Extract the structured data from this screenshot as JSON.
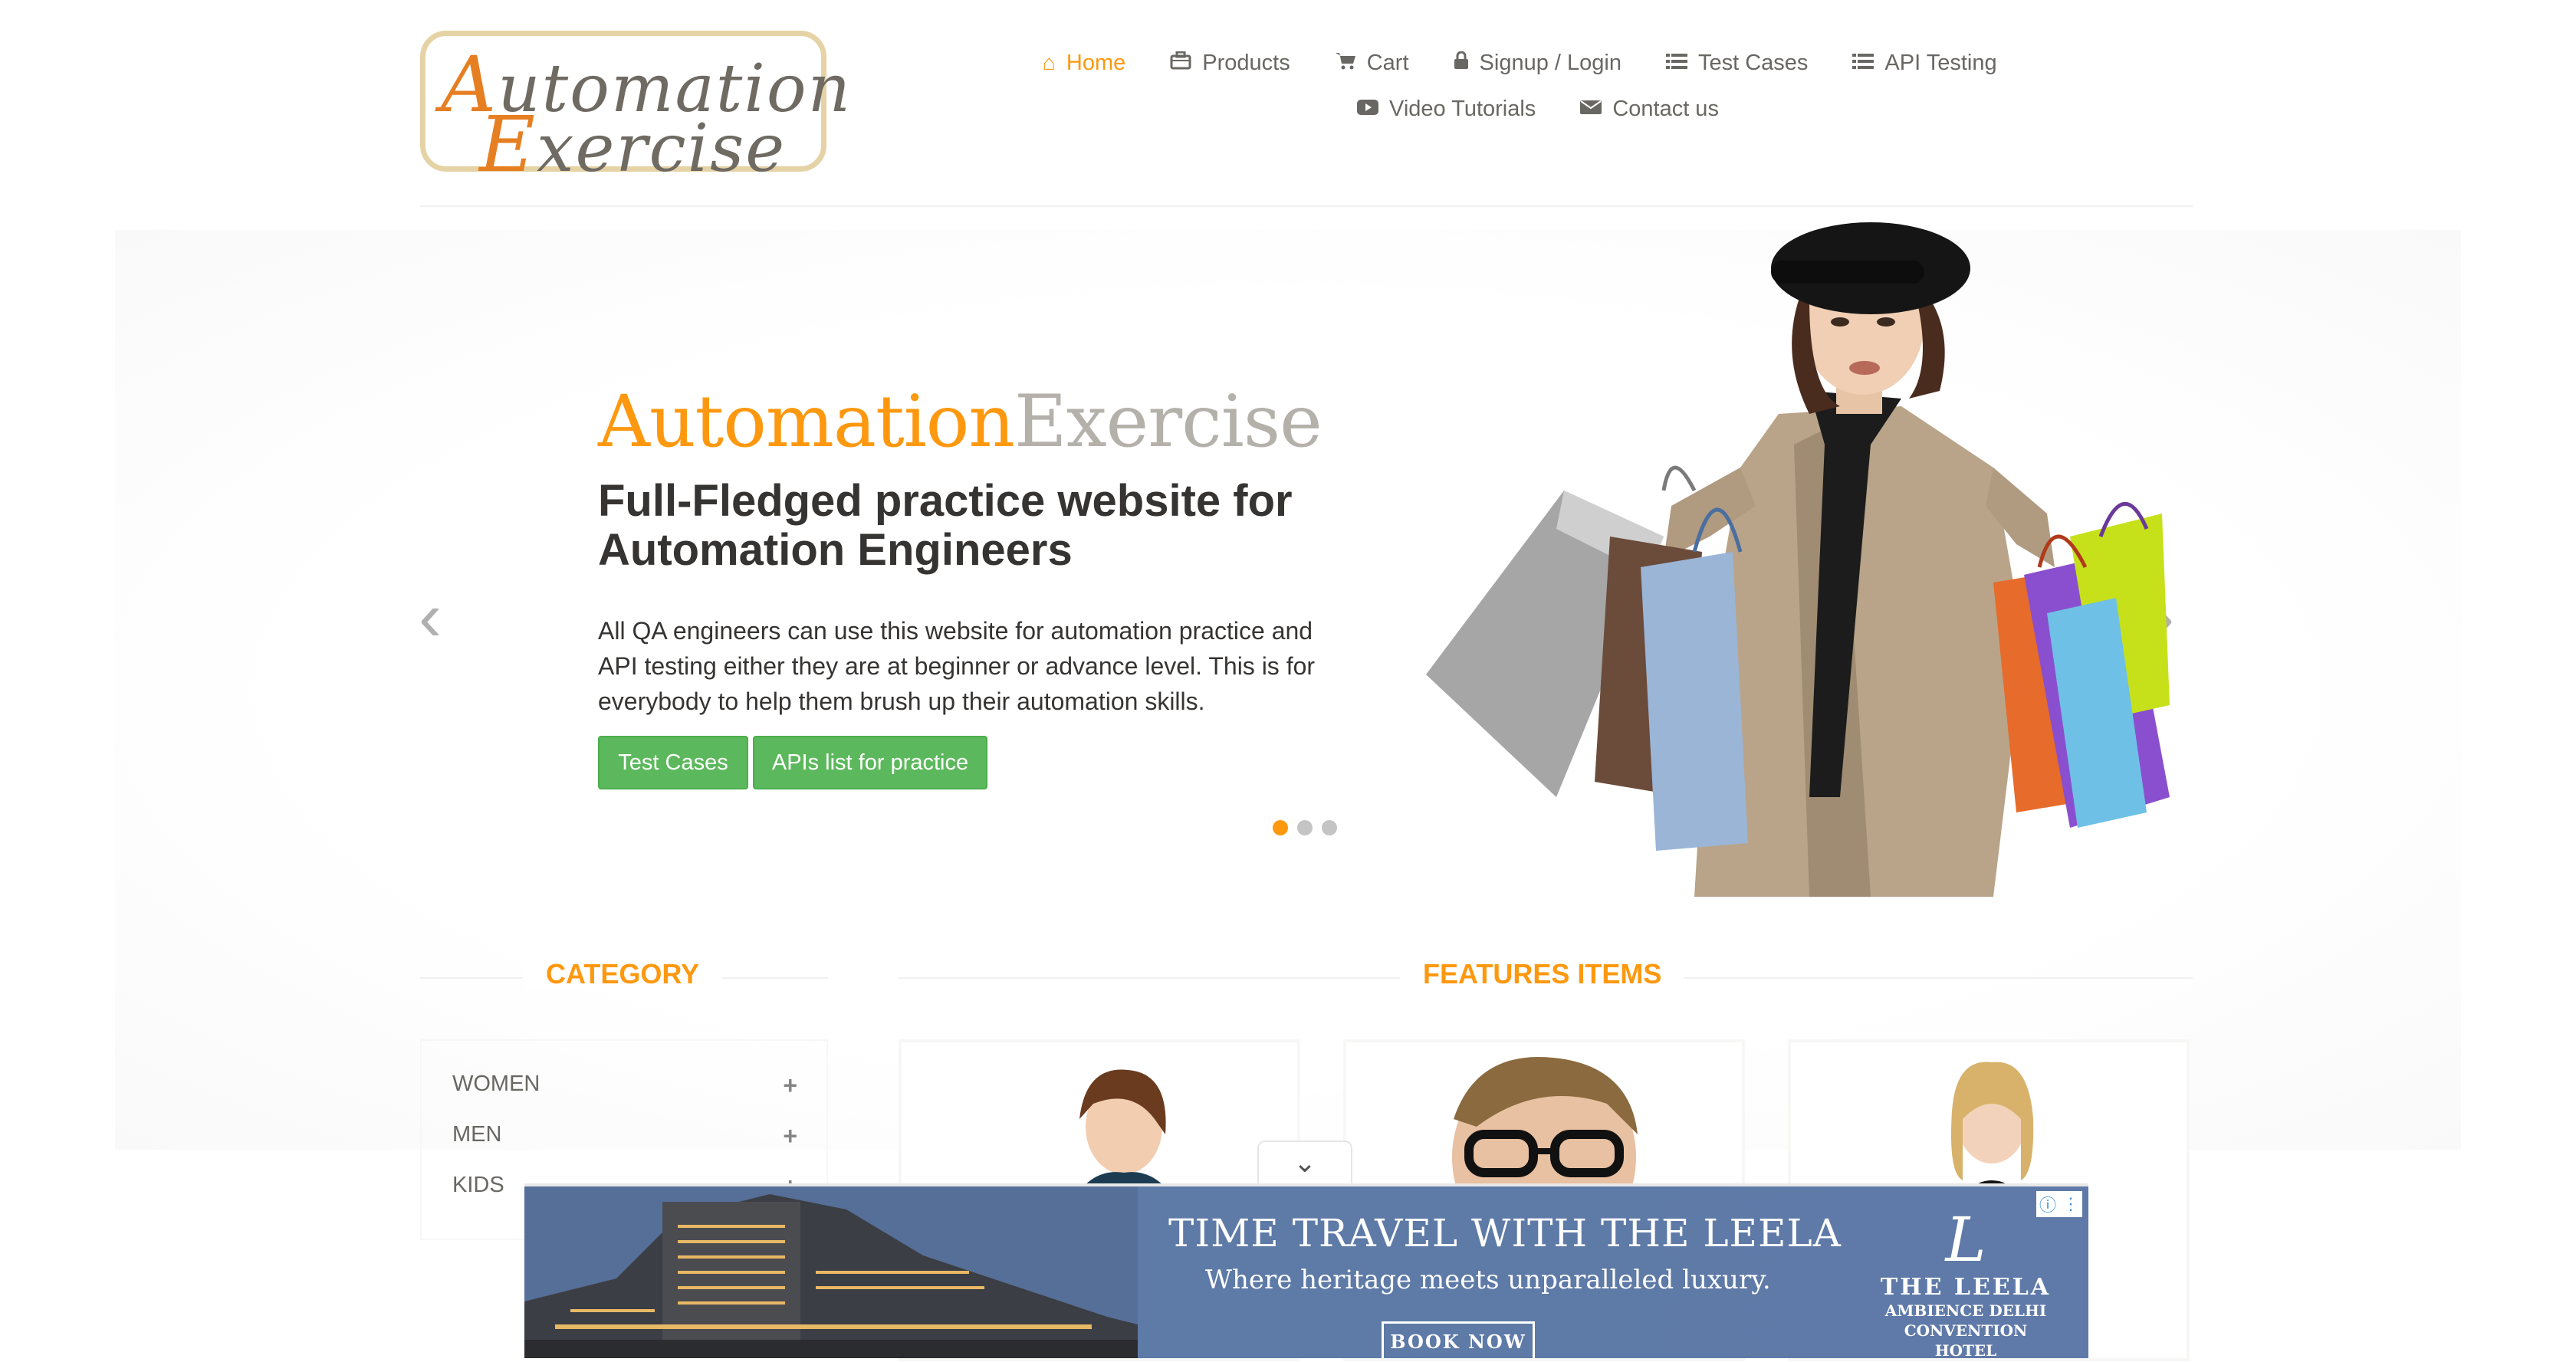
{
  "header": {
    "logo": {
      "line1_cap": "A",
      "line1_rest": "utomation",
      "line2_cap": "E",
      "line2_rest": "xercise"
    },
    "nav_row1": [
      {
        "label": "Home",
        "icon": "home-icon"
      },
      {
        "label": "Products",
        "icon": "briefcase-icon"
      },
      {
        "label": "Cart",
        "icon": "cart-icon"
      },
      {
        "label": "Signup / Login",
        "icon": "lock-icon"
      },
      {
        "label": "Test Cases",
        "icon": "list-icon"
      },
      {
        "label": "API Testing",
        "icon": "list-icon"
      }
    ],
    "nav_row2": [
      {
        "label": "Video Tutorials",
        "icon": "youtube-icon"
      },
      {
        "label": "Contact us",
        "icon": "envelope-icon"
      }
    ],
    "active_color": "#fe980f"
  },
  "slider": {
    "brand_a": "Automation",
    "brand_b": "Exercise",
    "headline": "Full-Fledged practice website for Automation Engineers",
    "description": "All QA engineers can use this website for automation practice and API testing either they are at beginner or advance level. This is for everybody to help them brush up their automation skills.",
    "button_test_cases": "Test Cases",
    "button_apis": "APIs list for practice",
    "active_slide": 1,
    "slide_count": 3
  },
  "sections": {
    "category_title": "CATEGORY",
    "features_title": "FEATURES ITEMS",
    "categories": [
      "WOMEN",
      "MEN",
      "KIDS"
    ]
  },
  "ad": {
    "headline": "TIME TRAVEL WITH THE LEELA",
    "subline": "Where heritage meets unparalleled luxury.",
    "button": "BOOK NOW",
    "brand_mark": "L",
    "brand_name": "THE LEELA",
    "brand_loc1": "AMBIENCE DELHI",
    "brand_loc2": "CONVENTION HOTEL"
  },
  "colors": {
    "accent": "#fe980f",
    "button_green": "#5cb85c",
    "ad_blue": "#5f7aa8"
  }
}
